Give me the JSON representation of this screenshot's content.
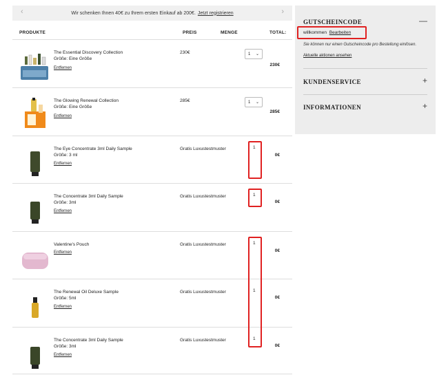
{
  "promo": {
    "text": "Wir schenken Ihnen 40€ zu Ihrem ersten Einkauf ab 200€.",
    "link": "Jetzt registrieren",
    "prev_icon": "chevron-left-icon",
    "next_icon": "chevron-right-icon"
  },
  "table": {
    "headers": {
      "products": "PRODUKTE",
      "price": "PREIS",
      "quantity": "MENGE",
      "total": "TOTAL:"
    },
    "items": [
      {
        "name": "The Essential Discovery Collection",
        "size": "Größe: Eine Größe",
        "remove": "Entfernen",
        "price": "230€",
        "qty": "1",
        "qty_type": "select",
        "total": "230€",
        "highlighted": false
      },
      {
        "name": "The Glowing Renewal Collection",
        "size": "Größe: Eine Größe",
        "remove": "Entfernen",
        "price": "285€",
        "qty": "1",
        "qty_type": "select",
        "total": "285€",
        "highlighted": false
      },
      {
        "name": "The Eye Concentrate 3ml Daily Sample",
        "size": "Größe: 3 ml",
        "remove": "Entfernen",
        "price": "Gratis Luxustestmuster",
        "qty": "1",
        "qty_type": "text",
        "total": "0€",
        "highlighted": true
      },
      {
        "name": "The Concentrate 3ml Daily Sample",
        "size": "Größe: 3ml",
        "remove": "Entfernen",
        "price": "Gratis Luxustestmuster",
        "qty": "1",
        "qty_type": "text",
        "total": "0€",
        "highlighted": true
      },
      {
        "name": "Valentine's Pouch",
        "size": "",
        "remove": "Entfernen",
        "price": "Gratis Luxustestmuster",
        "qty": "1",
        "qty_type": "text",
        "total": "0€",
        "highlighted": true
      },
      {
        "name": "The Renewal Oil Deluxe Sample",
        "size": "Größe: 5ml",
        "remove": "Entfernen",
        "price": "Gratis Luxustestmuster",
        "qty": "1",
        "qty_type": "text",
        "total": "0€",
        "highlighted": true
      },
      {
        "name": "The Concentrate 3ml Daily Sample",
        "size": "Größe: 3ml",
        "remove": "Entfernen",
        "price": "Gratis Luxustestmuster",
        "qty": "1",
        "qty_type": "text",
        "total": "0€",
        "highlighted": true
      }
    ]
  },
  "sidebar": {
    "coupon": {
      "title": "GUTSCHEINCODE",
      "toggle_icon": "minus-icon",
      "code": "willkommen",
      "edit": "Bearbeiten",
      "note": "Sie können nur einen Gutscheincode pro Bestellung einlösen.",
      "actions_link": "Aktuelle aktionen ansehen"
    },
    "service": {
      "title": "KUNDENSERVICE",
      "toggle_icon": "plus-icon"
    },
    "info": {
      "title": "INFORMATIONEN",
      "toggle_icon": "plus-icon"
    }
  },
  "colors": {
    "highlight": "#e02020",
    "panel": "#ededed"
  }
}
